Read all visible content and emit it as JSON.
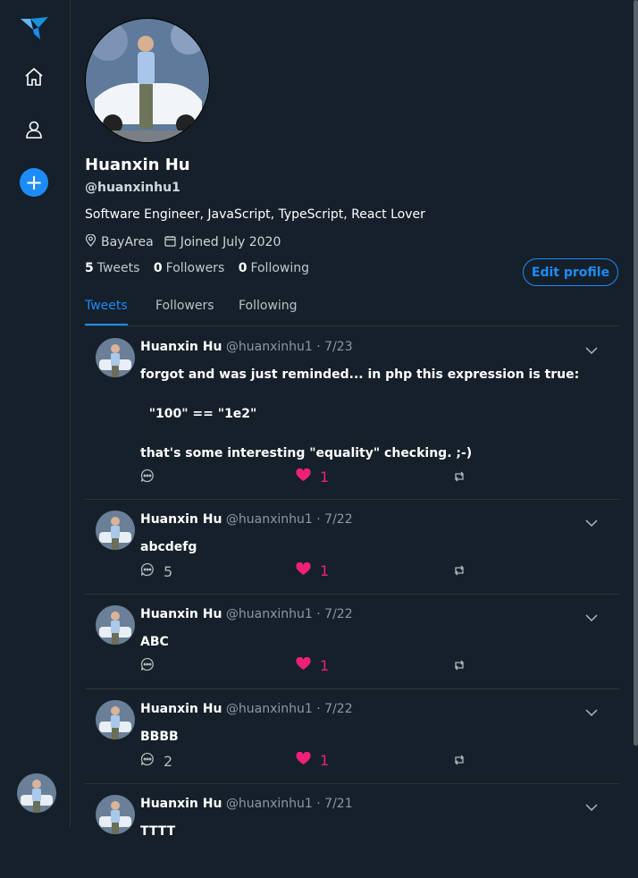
{
  "profile": {
    "name": "Huanxin Hu",
    "handle": "@huanxinhu1",
    "bio": "Software Engineer, JavaScript, TypeScript, React Lover",
    "location": "BayArea",
    "joined": "Joined July 2020",
    "stats": {
      "tweets_count": "5",
      "tweets_label": "Tweets",
      "followers_count": "0",
      "followers_label": "Followers",
      "following_count": "0",
      "following_label": "Following"
    },
    "edit_label": "Edit profile"
  },
  "tabs": [
    {
      "label": "Tweets",
      "active": true
    },
    {
      "label": "Followers",
      "active": false
    },
    {
      "label": "Following",
      "active": false
    }
  ],
  "tweets": [
    {
      "name": "Huanxin Hu",
      "meta": "@huanxinhu1 · 7/23",
      "body": "forgot and was just reminded... in php this expression is true:\n\n  \"100\" == \"1e2\"\n\nthat's some interesting \"equality\" checking. ;-)",
      "replies": "",
      "likes": "1"
    },
    {
      "name": "Huanxin Hu",
      "meta": "@huanxinhu1 · 7/22",
      "body": "abcdefg",
      "replies": "5",
      "likes": "1"
    },
    {
      "name": "Huanxin Hu",
      "meta": "@huanxinhu1 · 7/22",
      "body": "ABC",
      "replies": "",
      "likes": "1"
    },
    {
      "name": "Huanxin Hu",
      "meta": "@huanxinhu1 · 7/22",
      "body": "BBBB",
      "replies": "2",
      "likes": "1"
    },
    {
      "name": "Huanxin Hu",
      "meta": "@huanxinhu1 · 7/21",
      "body": "TTTT",
      "replies": "",
      "likes": ""
    }
  ],
  "colors": {
    "accent": "#1d8cf8",
    "like": "#f0207a",
    "background": "#15202b"
  },
  "icons": [
    "bird-logo-icon",
    "home-icon",
    "user-icon",
    "plus-icon",
    "location-icon",
    "calendar-icon",
    "chevron-down-icon",
    "reply-icon",
    "heart-icon",
    "retweet-icon"
  ]
}
